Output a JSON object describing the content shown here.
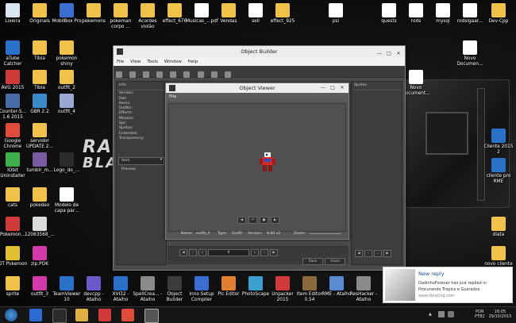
{
  "desktop_icons": [
    {
      "id": "i1",
      "label": "Lixeira",
      "color": "#d9e6f2"
    },
    {
      "id": "i2",
      "label": "Originals",
      "color": "#f0c24a"
    },
    {
      "id": "i3",
      "label": "MobilBox Pro",
      "color": "#3a6fd1"
    },
    {
      "id": "i4",
      "label": "pokemons",
      "color": "#f0c24a"
    },
    {
      "id": "i5",
      "label": "pokeman corpo ...",
      "color": "#f0c24a"
    },
    {
      "id": "i6",
      "label": "Acordes violão",
      "color": "#f0c24a"
    },
    {
      "id": "i7",
      "label": "effect_676",
      "color": "#f0c24a"
    },
    {
      "id": "i8",
      "label": "Musicas_...pdf",
      "color": "#ffffff"
    },
    {
      "id": "i9",
      "label": "Vendas",
      "color": "#f0c24a"
    },
    {
      "id": "i10",
      "label": "sell",
      "color": "#ffffff"
    },
    {
      "id": "i11",
      "label": "effect_925",
      "color": "#f0c24a"
    },
    {
      "id": "i12",
      "label": "psi",
      "color": "#ffffff"
    },
    {
      "id": "i13",
      "label": "quests",
      "color": "#ffffff"
    },
    {
      "id": "i14",
      "label": "rods",
      "color": "#ffffff"
    },
    {
      "id": "i15",
      "label": "mysql",
      "color": "#ffffff"
    },
    {
      "id": "i16",
      "label": "rodslgaar...",
      "color": "#ffffff"
    },
    {
      "id": "i17",
      "label": "Dev-Cpp",
      "color": "#f0c24a"
    },
    {
      "id": "i18",
      "label": "aTube Catcher",
      "color": "#2a72c9"
    },
    {
      "id": "i19",
      "label": "Tibia",
      "color": "#f0c24a"
    },
    {
      "id": "i20",
      "label": "pokemon shiny",
      "color": "#f0c24a"
    },
    {
      "id": "i21",
      "label": "Novo Documen...",
      "color": "#ffffff"
    },
    {
      "id": "i22",
      "label": "AVG 2015",
      "color": "#d13a3a"
    },
    {
      "id": "i23",
      "label": "Tibia",
      "color": "#f0c24a"
    },
    {
      "id": "i24",
      "label": "outfit_2",
      "color": "#f0c24a"
    },
    {
      "id": "i25",
      "label": "Novo Document...",
      "color": "#ffffff"
    },
    {
      "id": "i26",
      "label": "Counter-S... 1.6 2015",
      "color": "#4a6da8"
    },
    {
      "id": "i27",
      "label": "GBR 2.2",
      "color": "#3a8ac9"
    },
    {
      "id": "i28",
      "label": "outfit_4",
      "color": "#9aa8d6"
    },
    {
      "id": "i29",
      "label": "Google Chrome",
      "color": "#e04b3a"
    },
    {
      "id": "i30",
      "label": "servidor UPDATE 2...",
      "color": "#f0c24a"
    },
    {
      "id": "i31",
      "label": "Cliente 2015 2",
      "color": "#2a72c9"
    },
    {
      "id": "i32",
      "label": "IObit Uninstaller",
      "color": "#3fb04a"
    },
    {
      "id": "i33",
      "label": "tumblr_m...",
      "color": "#7a5aa0"
    },
    {
      "id": "i34",
      "label": "Logo_do_...",
      "color": "#2b2b2b"
    },
    {
      "id": "i35",
      "label": "cliente pro RME",
      "color": "#2a72c9"
    },
    {
      "id": "i36",
      "label": "cats",
      "color": "#f0c24a"
    },
    {
      "id": "i37",
      "label": "pokedex",
      "color": "#f0c24a"
    },
    {
      "id": "i38",
      "label": "Modelo de capa par...",
      "color": "#ffffff"
    },
    {
      "id": "i39",
      "label": "Pokemon...",
      "color": "#d13a3a"
    },
    {
      "id": "i40",
      "label": "12063568_...",
      "color": "#dcdcdc"
    },
    {
      "id": "i41",
      "label": "dlata",
      "color": "#f0c24a"
    },
    {
      "id": "i42",
      "label": "OT Pokemon",
      "color": "#e0c030"
    },
    {
      "id": "i43",
      "label": "zip.POK",
      "color": "#d13aa8"
    },
    {
      "id": "i44",
      "label": "novo cliente",
      "color": "#f0c24a"
    },
    {
      "id": "i45",
      "label": "sprite",
      "color": "#f0c24a"
    },
    {
      "id": "i46",
      "label": "outfit_3",
      "color": "#d13aa8"
    },
    {
      "id": "i47",
      "label": "TeamViewer 10",
      "color": "#2a72c9"
    },
    {
      "id": "i48",
      "label": "devcpp - Atalho",
      "color": "#6a5ac9"
    },
    {
      "id": "i49",
      "label": "XVI32 - Atalho",
      "color": "#2a72c9"
    },
    {
      "id": "i50",
      "label": "SpellCrea... - Atalho",
      "color": "#8a8a8a"
    },
    {
      "id": "i51",
      "label": "Object Builder",
      "color": "#3c3c3c"
    },
    {
      "id": "i52",
      "label": "Inno Setup Compiler",
      "color": "#3a6fd1"
    },
    {
      "id": "i53",
      "label": "Pic Editor",
      "color": "#e08030"
    },
    {
      "id": "i54",
      "label": "PhotoScape",
      "color": "#3aa0d1"
    },
    {
      "id": "i55",
      "label": "Unpacker 2015",
      "color": "#d13a3a"
    },
    {
      "id": "i56",
      "label": "Item Editor 0.54",
      "color": "#8a6a3a"
    },
    {
      "id": "i57",
      "label": "RME - Atalho",
      "color": "#5a8ad1"
    },
    {
      "id": "i58",
      "label": "ResHacker - Atalho",
      "color": "#8a8a8a"
    }
  ],
  "brand": {
    "text1": "RA",
    "text2": "BLA"
  },
  "object_builder": {
    "title": "Object Builder",
    "menu": [
      "File",
      "View",
      "Tools",
      "Window",
      "Help"
    ],
    "info_header": "Info",
    "info_items": [
      "Version:",
      "Dat:",
      "Items:",
      "Outfits:",
      "Effects:",
      "Missiles:",
      "Spr:",
      "Sprites:",
      "Extended:",
      "Transparency:"
    ],
    "category": "Item",
    "preview_label": "Preview",
    "sprites_header": "Sprites",
    "page_value": "0",
    "save_label": "Save",
    "close_label": "Close"
  },
  "object_viewer": {
    "title": "Object Viewer",
    "menu_file": "File",
    "status_name_label": "Name:",
    "status_name": "outfit_4",
    "status_type_label": "Type:",
    "status_type": "Outfit",
    "status_version_label": "Version:",
    "status_version": "8.60 v2",
    "zoom_label": "Zoom:"
  },
  "notification": {
    "title": "New reply",
    "line1": "DadinhoForever has just replied in",
    "line2": "Procurando Tropics e Gyarados",
    "link": "www.tibiaking.com"
  },
  "taskbar": {
    "lang1": "POR",
    "lang2": "PTB2",
    "time": "16:05",
    "date": "29/10/2015"
  }
}
